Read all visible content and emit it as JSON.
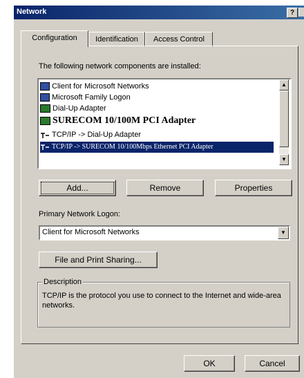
{
  "window": {
    "title": "Network",
    "help_glyph": "?"
  },
  "tabs": [
    {
      "label": "Configuration",
      "active": true
    },
    {
      "label": "Identification",
      "active": false
    },
    {
      "label": "Access Control",
      "active": false
    }
  ],
  "components": {
    "heading": "The following network components are installed:",
    "items": [
      {
        "label": "Client for Microsoft Networks",
        "icon": "network-client-icon"
      },
      {
        "label": "Microsoft Family Logon",
        "icon": "network-client-icon"
      },
      {
        "label": "Dial-Up Adapter",
        "icon": "adapter-icon"
      },
      {
        "label": "SURECOM 10/100M PCI Adapter",
        "icon": "adapter-icon"
      },
      {
        "label": "TCP/IP -> Dial-Up Adapter",
        "icon": "protocol-icon"
      },
      {
        "label": "TCP/IP -> SURECOM 10/100Mbps Ethernet PCI Adapter",
        "icon": "protocol-icon",
        "selected": true
      }
    ]
  },
  "buttons": {
    "add": "Add...",
    "remove": "Remove",
    "properties": "Properties",
    "file_print": "File and Print Sharing...",
    "ok": "OK",
    "cancel": "Cancel"
  },
  "logon": {
    "label": "Primary Network Logon:",
    "value": "Client for Microsoft Networks"
  },
  "description": {
    "title": "Description",
    "text": "TCP/IP is the protocol you use to connect to the Internet and wide-area networks."
  },
  "colors": {
    "title_bar": "#0a246a",
    "face": "#d4d0c8",
    "selection": "#0a246a"
  }
}
